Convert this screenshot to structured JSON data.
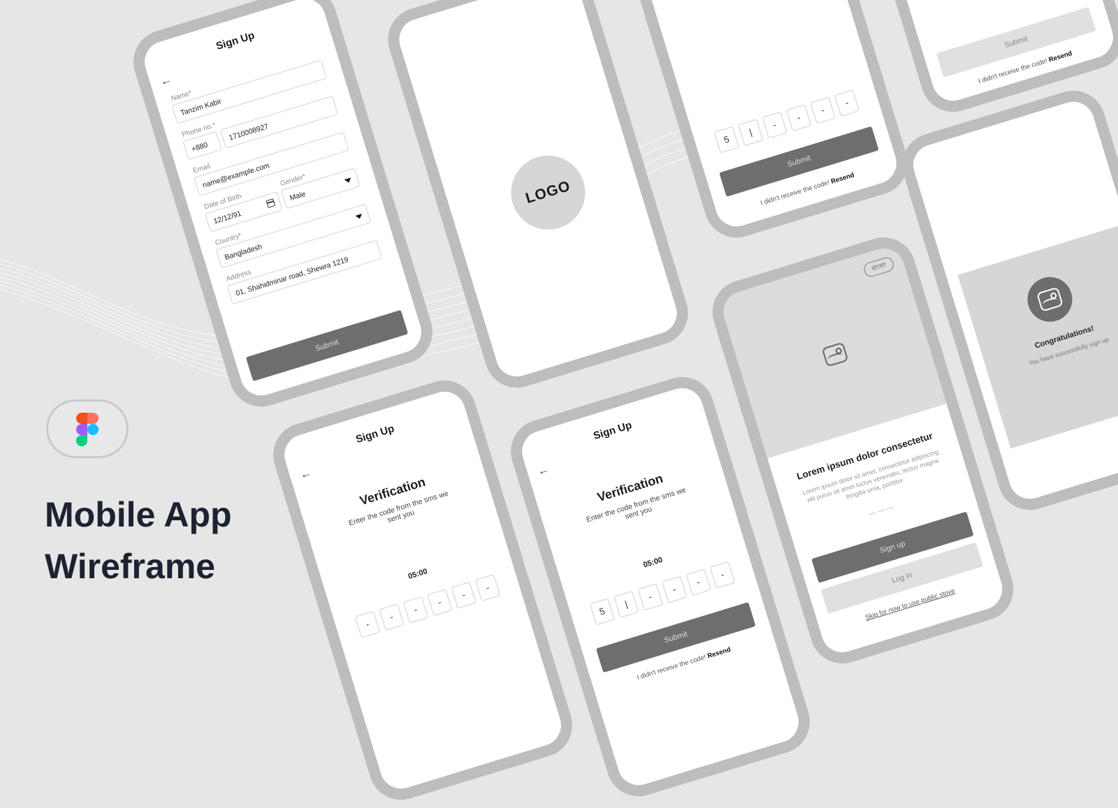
{
  "headline": {
    "line1": "Mobile App",
    "line2": "Wireframe"
  },
  "signup_form": {
    "title": "Sign Up",
    "name_label": "Name*",
    "name_value": "Tanzim Kabir",
    "phone_label": "Phone no.*",
    "phone_code": "+880",
    "phone_value": "1710008927",
    "email_label": "Email",
    "email_value": "name@example.com",
    "dob_label": "Date of Birth",
    "dob_value": "12/12/91",
    "gender_label": "Gender*",
    "gender_value": "Male",
    "country_label": "Country*",
    "country_value": "Bangladesh",
    "address_label": "Address",
    "address_value": "01, Shahidminar road, Shewra 1219",
    "submit_label": "Submit"
  },
  "splash": {
    "logo_text": "LOGO"
  },
  "verify_partial": {
    "digits": [
      "5",
      "|",
      "-",
      "-",
      "-",
      "-"
    ],
    "submit_label": "Submit",
    "resend_prefix": "I didn't receive the code!",
    "resend_link": "Resend"
  },
  "verify_partial_top": {
    "submit_label": "Submit",
    "resend_prefix": "I didn't receive the code!",
    "resend_link": "Resend"
  },
  "verify_empty": {
    "title": "Sign Up",
    "heading": "Verification",
    "subtitle": "Enter the code from the sms we sent you",
    "timer": "05:00",
    "digits": [
      "-",
      "-",
      "-",
      "-",
      "-",
      "-"
    ]
  },
  "verify_typing": {
    "title": "Sign Up",
    "heading": "Verification",
    "subtitle": "Enter the code from the sms we sent you",
    "timer": "05:00",
    "digits": [
      "5",
      "|",
      "-",
      "-",
      "-",
      "-"
    ],
    "submit_label": "Submit",
    "resend_prefix": "I didn't receive the code!",
    "resend_link": "Resend"
  },
  "onboarding": {
    "language_label": "বাংলা",
    "heading": "Lorem ipsum dolor consectetur",
    "body": "Lorem ipsum dolor sit amet, consectetur adipiscing elit purus sit amet luctus venenatis, lectus magna fringilla urna, porttitor.",
    "dots": "— — —",
    "signup_label": "Sign up",
    "login_label": "Log in",
    "skip_label": "Skip for now to use public stove"
  },
  "success": {
    "heading": "Congratulations!",
    "body": "You have successfully sign up",
    "close_label": "×"
  }
}
